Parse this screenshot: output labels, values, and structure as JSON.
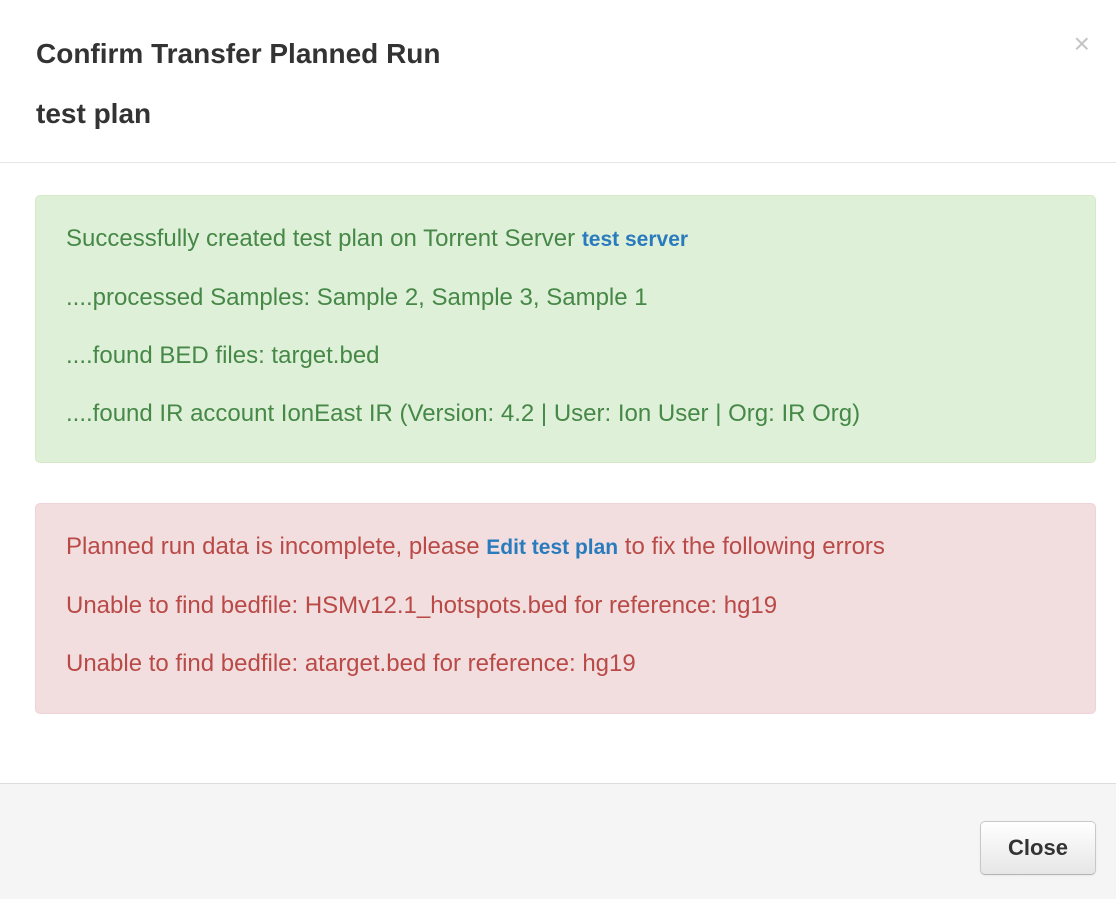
{
  "modal": {
    "title": "Confirm Transfer Planned Run",
    "subtitle": "test plan",
    "close_icon": "×"
  },
  "success_alert": {
    "line1_text": "Successfully created test plan on Torrent Server ",
    "line1_link": "test server",
    "line2": "....processed Samples: Sample 2, Sample 3, Sample 1",
    "line3": "....found BED files: target.bed",
    "line4": "....found IR account IonEast IR (Version: 4.2 | User: Ion User | Org: IR Org)"
  },
  "error_alert": {
    "line1_before": "Planned run data is incomplete, please ",
    "line1_link": "Edit test plan",
    "line1_after": " to fix the following errors",
    "line2": "Unable to find bedfile: HSMv12.1_hotspots.bed for reference: hg19",
    "line3": "Unable to find bedfile: atarget.bed for reference: hg19"
  },
  "footer": {
    "close_label": "Close"
  },
  "colors": {
    "success_bg": "#dff0d8",
    "success_text": "#468847",
    "error_bg": "#f2dede",
    "error_text": "#b94a48",
    "link": "#2a7bbd"
  }
}
